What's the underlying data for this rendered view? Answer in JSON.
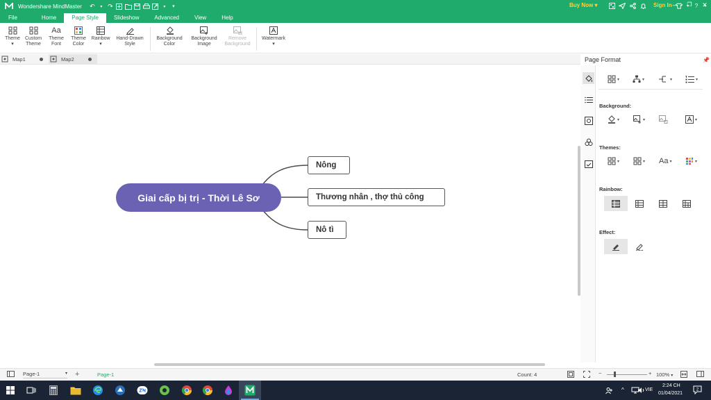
{
  "app": {
    "title": "Wondershare MindMaster",
    "buy_now": "Buy Now",
    "buy_now_caret": "▾",
    "sign_in": "Sign In"
  },
  "menu": {
    "tabs": [
      "File",
      "Home",
      "Page Style",
      "Slideshow",
      "Advanced",
      "View",
      "Help"
    ],
    "active": "Page Style"
  },
  "ribbon": {
    "theme": "Theme",
    "custom_theme_1": "Custom",
    "custom_theme_2": "Theme",
    "theme_font_1": "Theme",
    "theme_font_2": "Font",
    "theme_color_1": "Theme",
    "theme_color_2": "Color",
    "rainbow": "Rainbow",
    "hand_drawn_1": "Hand-Drawn",
    "hand_drawn_2": "Style",
    "bg_color_1": "Background",
    "bg_color_2": "Color",
    "bg_image_1": "Background",
    "bg_image_2": "Image",
    "remove_bg_1": "Remove",
    "remove_bg_2": "Background",
    "watermark": "Watermark"
  },
  "doc_tabs": [
    {
      "label": "Map1"
    },
    {
      "label": "Map2"
    }
  ],
  "mindmap": {
    "central": "Giai cấp bị trị - Thời Lê Sơ",
    "topics": [
      "Nông",
      "Thương nhân , thợ thủ công",
      "Nô tì"
    ]
  },
  "panel": {
    "title": "Page Format",
    "background": "Background:",
    "themes": "Themes:",
    "rainbow": "Rainbow:",
    "effect": "Effect:"
  },
  "status": {
    "page_select": "Page-1",
    "page_tab": "Page-1",
    "count": "Count: 4",
    "zoom": "100%"
  },
  "taskbar": {
    "lang": "VIE",
    "time": "2:24 CH",
    "date": "01/04/2021",
    "notifications": "2"
  },
  "colors": {
    "brand": "#1eab6b",
    "central_topic": "#6b62b3",
    "buy_now": "#ffd23f",
    "taskbar": "#1a2434"
  }
}
